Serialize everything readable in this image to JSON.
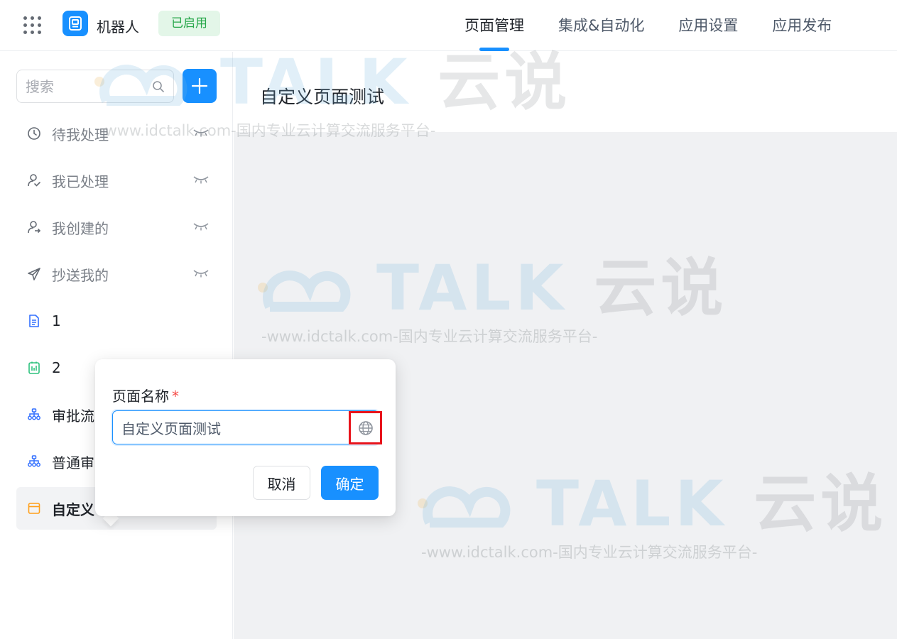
{
  "header": {
    "app_name": "机器人",
    "status": "已启用",
    "tabs": [
      {
        "label": "页面管理",
        "active": true
      },
      {
        "label": "集成&自动化",
        "active": false
      },
      {
        "label": "应用设置",
        "active": false
      },
      {
        "label": "应用发布",
        "active": false
      }
    ]
  },
  "sidebar": {
    "search_placeholder": "搜索",
    "items": [
      {
        "label": "待我处理",
        "icon": "clock-icon",
        "hidden": true
      },
      {
        "label": "我已处理",
        "icon": "user-check-icon",
        "hidden": true
      },
      {
        "label": "我创建的",
        "icon": "user-arrow-icon",
        "hidden": true
      },
      {
        "label": "抄送我的",
        "icon": "paper-plane-icon",
        "hidden": true
      },
      {
        "label": "1",
        "icon": "document-icon",
        "hidden": false
      },
      {
        "label": "2",
        "icon": "report-icon",
        "hidden": false
      },
      {
        "label": "审批流",
        "icon": "flow-icon",
        "hidden": false
      },
      {
        "label": "普通审",
        "icon": "flow-icon",
        "hidden": false
      },
      {
        "label": "自定义",
        "icon": "custom-page-icon",
        "hidden": false,
        "active": true
      }
    ]
  },
  "main": {
    "page_title": "自定义页面测试"
  },
  "popover": {
    "field_label": "页面名称",
    "required_mark": "*",
    "input_value": "自定义页面测试",
    "lang_icon": "globe-icon",
    "cancel_label": "取消",
    "ok_label": "确定"
  },
  "watermark": {
    "brand_latin": "TALK",
    "brand_cn": "云说",
    "tagline": "-www.idctalk.com-国内专业云计算交流服务平台-"
  },
  "colors": {
    "accent": "#1890ff",
    "status_bg": "#e3f6e8",
    "status_text": "#27a74a",
    "highlight_box": "#e8141c",
    "required": "#f54a45"
  }
}
